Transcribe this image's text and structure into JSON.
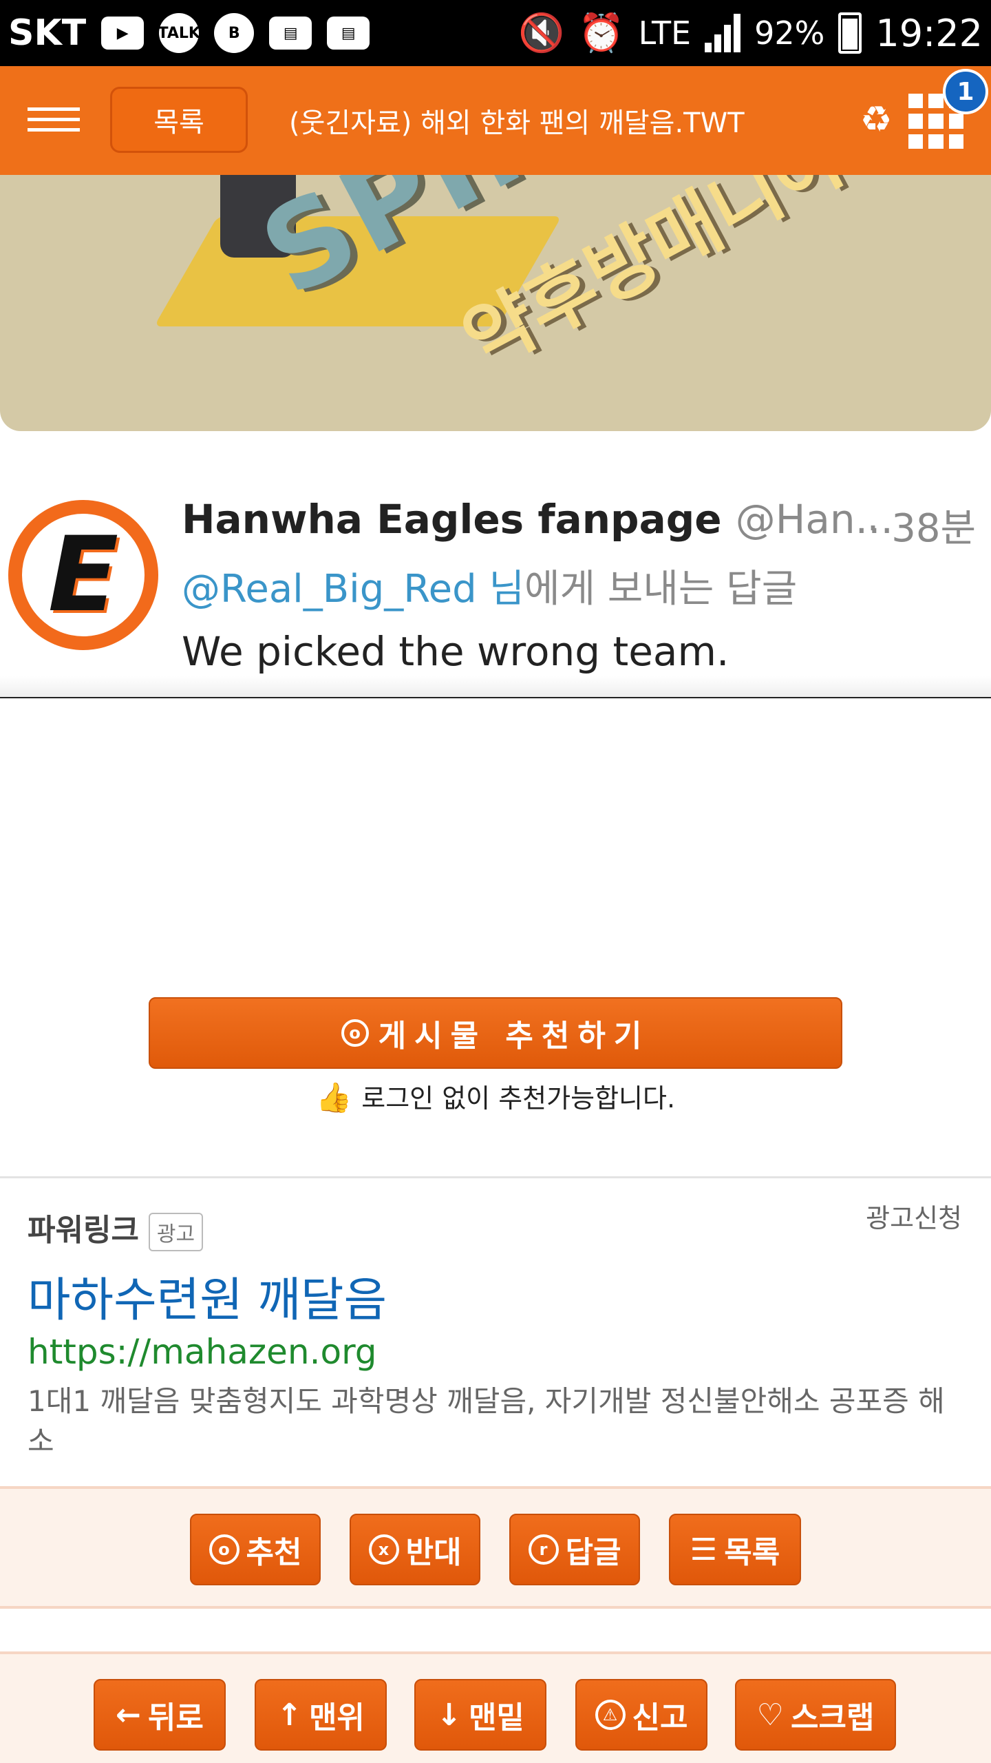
{
  "status_bar": {
    "carrier": "SKT",
    "network": "LTE",
    "battery": "92%",
    "time": "19:22"
  },
  "header": {
    "list_button": "목록",
    "title": "(웃긴자료) 해외 한화 팬의 깨달음.TWT",
    "notification_count": "1"
  },
  "hero": {
    "text_main": "SPINO",
    "text_sub": "약후방매니아"
  },
  "tweet": {
    "name": "Hanwha Eagles fanpage",
    "handle": "@Han...",
    "time": "· 38분",
    "reply_mention": "@Real_Big_Red 님",
    "reply_suffix": "에게 보내는 답글",
    "body": "We picked the wrong team.",
    "avatar_letter": "E"
  },
  "recommend": {
    "button_label": "게시물  추천하기",
    "note": "로그인 없이 추천가능합니다."
  },
  "ad": {
    "label": "파워링크",
    "tag": "광고",
    "apply": "광고신청",
    "title": "마하수련원 깨달음",
    "url": "https://mahazen.org",
    "description": "1대1 깨달음 맞춤형지도 과학명상 깨달음, 자기개발 정신불안해소 공포증 해소"
  },
  "actions": {
    "recommend": "추천",
    "oppose": "반대",
    "reply": "답글",
    "list": "목록"
  },
  "bottom_nav": {
    "back": "뒤로",
    "top": "맨위",
    "bottom": "맨밑",
    "report": "신고",
    "scrap": "스크랩"
  }
}
